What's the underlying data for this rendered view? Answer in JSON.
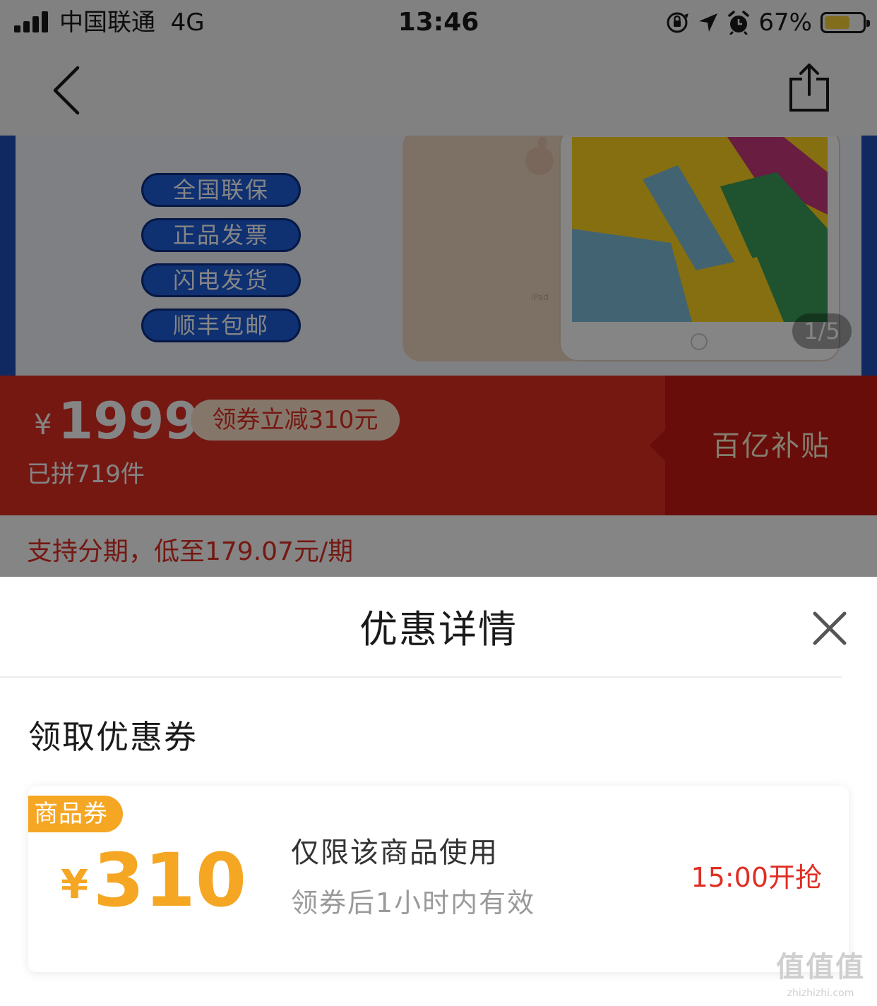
{
  "status_bar": {
    "carrier": "中国联通",
    "network": "4G",
    "time": "13:46",
    "battery_percent": "67%",
    "battery_level": 0.67,
    "battery_color": "#f8d136"
  },
  "nav": {
    "back_icon": "chevron-left-icon",
    "share_icon": "share-icon"
  },
  "gallery": {
    "badges": [
      "全国联保",
      "正品发票",
      "闪电发货",
      "顺丰包邮"
    ],
    "tablet_brand": "iPad",
    "counter": "1/5"
  },
  "price_banner": {
    "currency": "¥",
    "price": "1999",
    "coupon_tag": "领券立减310元",
    "sold": "已拼719件",
    "subsidy": "百亿补贴",
    "accent_color": "#e02e24"
  },
  "installment": {
    "text": "支持分期，低至179.07元/期"
  },
  "sheet": {
    "title": "优惠详情",
    "close_icon": "close-icon",
    "section_label": "领取优惠券",
    "coupon": {
      "badge": "商品券",
      "currency": "¥",
      "amount": "310",
      "scope": "仅限该商品使用",
      "validity": "领券后1小时内有效",
      "start_time": "15:00开抢",
      "color": "#f5a623"
    }
  },
  "watermark": {
    "main": "值值值",
    "sub": "zhizhizhi.com"
  }
}
